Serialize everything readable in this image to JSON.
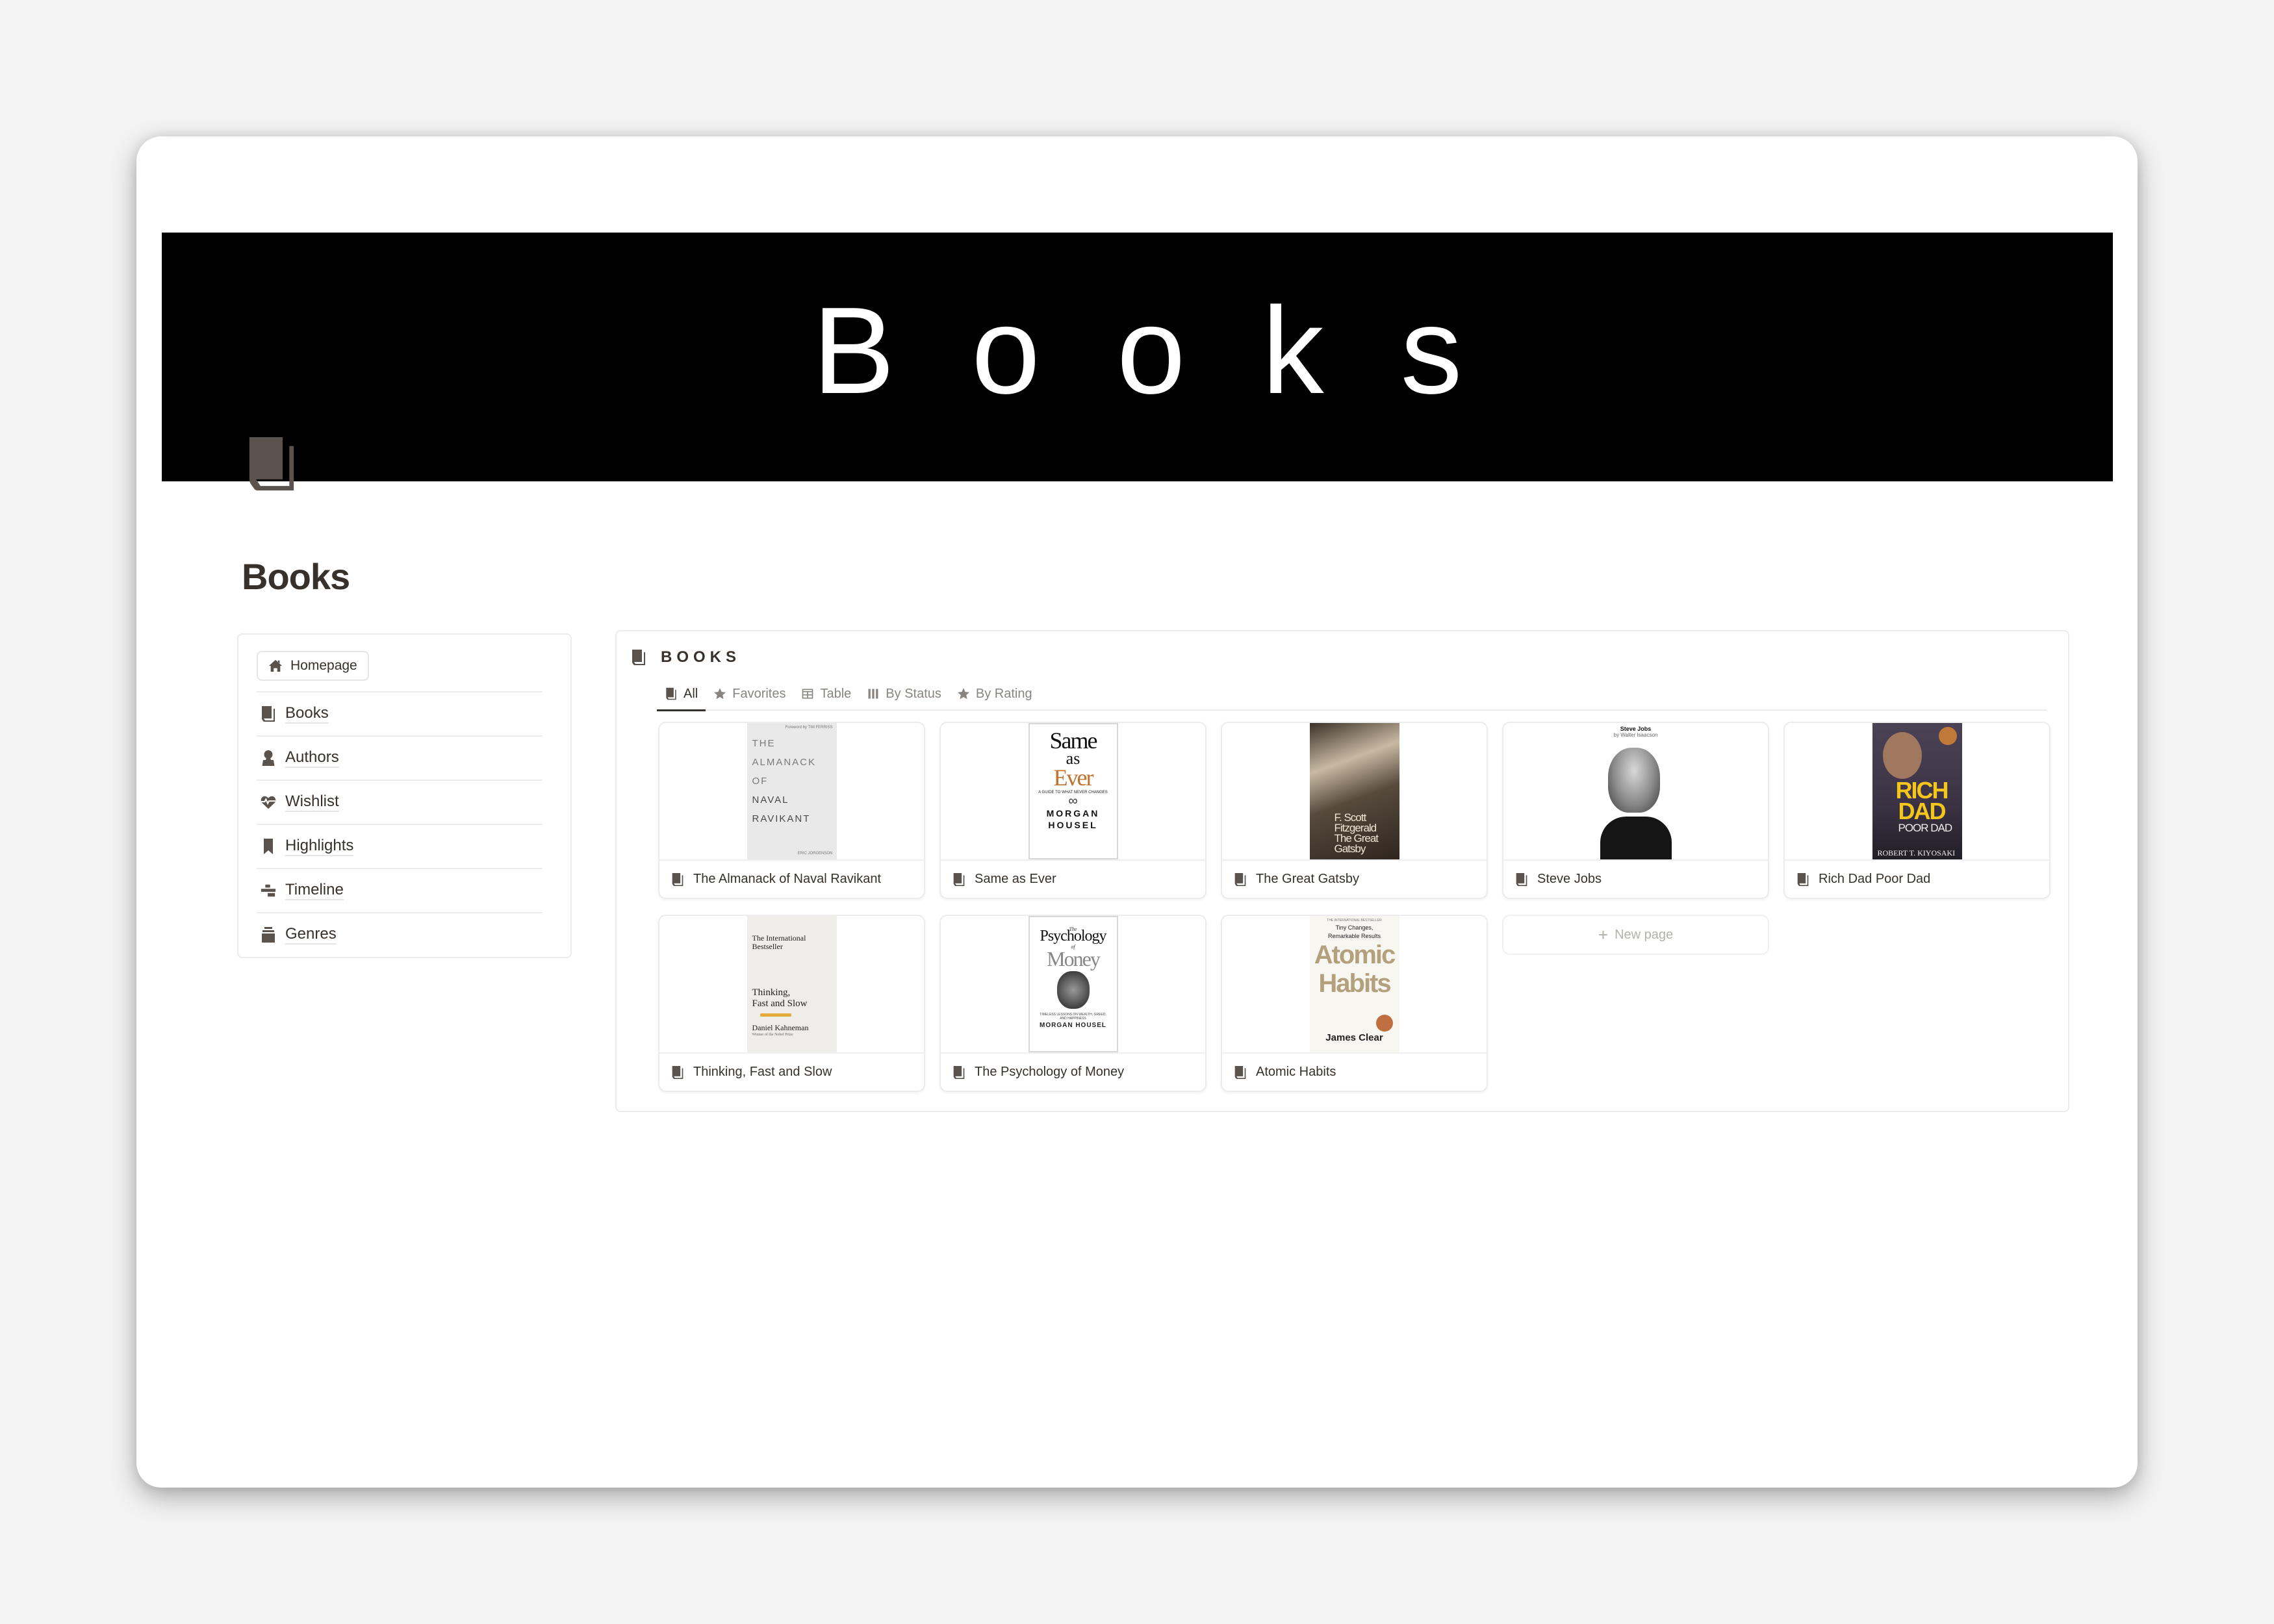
{
  "cover": {
    "title": "Books"
  },
  "page": {
    "title": "Books",
    "icon": "book-icon"
  },
  "colors": {
    "text": "#37302b",
    "muted": "#8a8480",
    "banner": "#000000",
    "border": "#ececec"
  },
  "sidebar": {
    "homepage_button": {
      "label": "Homepage",
      "icon": "home-icon"
    },
    "items": [
      {
        "label": "Books",
        "icon": "book-icon"
      },
      {
        "label": "Authors",
        "icon": "person-icon"
      },
      {
        "label": "Wishlist",
        "icon": "heart-pulse-icon"
      },
      {
        "label": "Highlights",
        "icon": "bookmark-icon"
      },
      {
        "label": "Timeline",
        "icon": "timeline-icon"
      },
      {
        "label": "Genres",
        "icon": "archive-icon"
      }
    ]
  },
  "database": {
    "title": "BOOKS",
    "icon": "book-icon",
    "tabs": [
      {
        "label": "All",
        "icon": "book-icon",
        "active": true
      },
      {
        "label": "Favorites",
        "icon": "star-icon",
        "active": false
      },
      {
        "label": "Table",
        "icon": "table-icon",
        "active": false
      },
      {
        "label": "By Status",
        "icon": "board-icon",
        "active": false
      },
      {
        "label": "By Rating",
        "icon": "star-icon",
        "active": false
      }
    ],
    "cards": [
      {
        "title": "The Almanack of Naval Ravikant",
        "cover": {
          "lines": [
            "THE",
            "ALMANACK",
            "OF",
            "NAVAL",
            "RAVIKANT"
          ],
          "top": "Foreword by TIM FERRISS",
          "bottom": "ERIC JORGENSON"
        }
      },
      {
        "title": "Same as Ever",
        "cover": {
          "lines": [
            "Same",
            "as",
            "Ever"
          ],
          "subtitle": "A GUIDE TO WHAT NEVER CHANGES",
          "author": [
            "MORGAN",
            "HOUSEL"
          ]
        }
      },
      {
        "title": "The Great Gatsby",
        "cover": {
          "lines": [
            "F. Scott",
            "Fitzgerald",
            "The Great",
            "Gatsby"
          ]
        }
      },
      {
        "title": "Steve Jobs",
        "cover": {
          "lines": [
            "Steve Jobs",
            "by Walter Isaacson"
          ]
        }
      },
      {
        "title": "Rich Dad Poor Dad",
        "cover": {
          "lines": [
            "RICH",
            "DAD",
            "POOR DAD"
          ],
          "author": "ROBERT T. KIYOSAKI"
        }
      },
      {
        "title": "Thinking, Fast and Slow",
        "cover": {
          "lines": [
            "The International",
            "Bestseller",
            "Thinking,",
            "Fast and Slow"
          ],
          "author": "Daniel Kahneman",
          "note": "Winner of the Nobel Prize"
        }
      },
      {
        "title": "The Psychology of Money",
        "cover": {
          "lines": [
            "The",
            "Psychology",
            "of",
            "Money"
          ],
          "subtitle": "TIMELESS LESSONS ON WEALTH, GREED, AND HAPPINESS",
          "author": "MORGAN HOUSEL"
        }
      },
      {
        "title": "Atomic Habits",
        "cover": {
          "top": "THE INTERNATIONAL BESTSELLER",
          "tagline": [
            "Tiny Changes,",
            "Remarkable Results"
          ],
          "lines": [
            "Atomic",
            "Habits"
          ],
          "author": "James Clear"
        }
      }
    ],
    "new_page": {
      "label": "New page",
      "icon": "plus-icon"
    }
  }
}
